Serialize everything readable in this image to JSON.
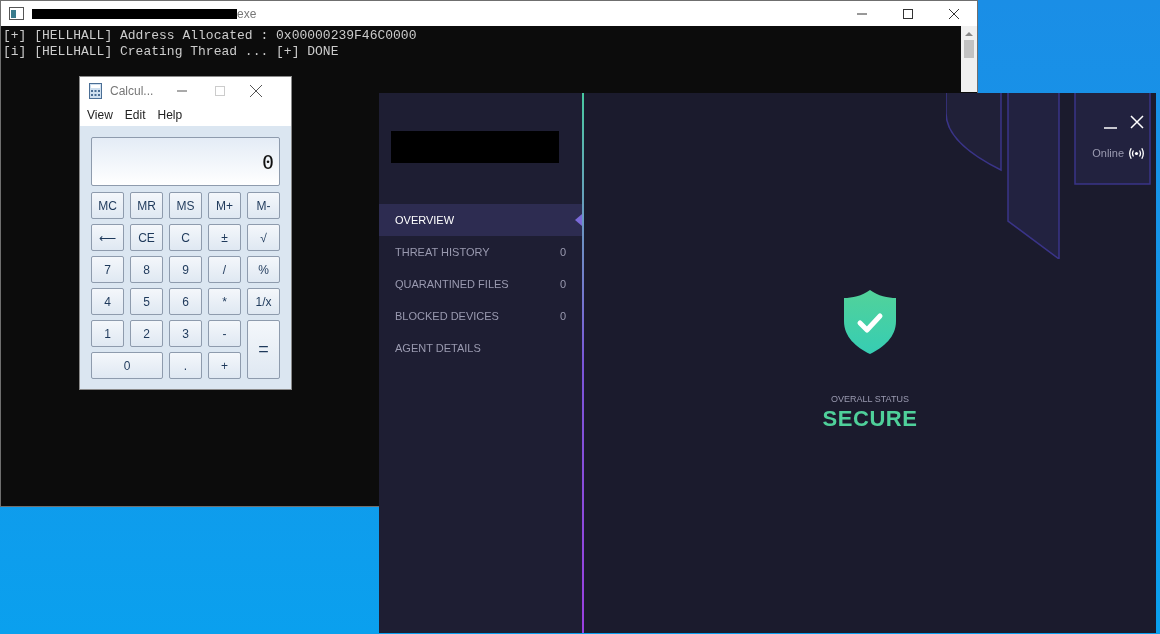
{
  "console": {
    "title": "exe",
    "lines": [
      "[+] [HELLHALL] Address Allocated : 0x00000239F46C0000",
      "[i] [HELLHALL] Creating Thread ... [+] DONE"
    ]
  },
  "calculator": {
    "title": "Calcul...",
    "menu": [
      "View",
      "Edit",
      "Help"
    ],
    "display": "0",
    "keys": [
      {
        "label": "MC",
        "kind": "key"
      },
      {
        "label": "MR",
        "kind": "key"
      },
      {
        "label": "MS",
        "kind": "key"
      },
      {
        "label": "M+",
        "kind": "key"
      },
      {
        "label": "M-",
        "kind": "key"
      },
      {
        "label": "⟵",
        "kind": "key"
      },
      {
        "label": "CE",
        "kind": "key"
      },
      {
        "label": "C",
        "kind": "key"
      },
      {
        "label": "±",
        "kind": "key"
      },
      {
        "label": "√",
        "kind": "key"
      },
      {
        "label": "7",
        "kind": "key"
      },
      {
        "label": "8",
        "kind": "key"
      },
      {
        "label": "9",
        "kind": "key"
      },
      {
        "label": "/",
        "kind": "key"
      },
      {
        "label": "%",
        "kind": "key"
      },
      {
        "label": "4",
        "kind": "key"
      },
      {
        "label": "5",
        "kind": "key"
      },
      {
        "label": "6",
        "kind": "key"
      },
      {
        "label": "*",
        "kind": "key"
      },
      {
        "label": "1/x",
        "kind": "key"
      },
      {
        "label": "1",
        "kind": "key"
      },
      {
        "label": "2",
        "kind": "key"
      },
      {
        "label": "3",
        "kind": "key"
      },
      {
        "label": "-",
        "kind": "key"
      },
      {
        "label": "=",
        "kind": "tall"
      },
      {
        "label": "0",
        "kind": "wide"
      },
      {
        "label": ".",
        "kind": "key"
      },
      {
        "label": "+",
        "kind": "key"
      }
    ]
  },
  "security_app": {
    "connection": "Online",
    "sidebar": {
      "items": [
        {
          "label": "OVERVIEW",
          "selected": true
        },
        {
          "label": "THREAT HISTORY",
          "count": "0",
          "selected": false
        },
        {
          "label": "QUARANTINED FILES",
          "count": "0",
          "selected": false
        },
        {
          "label": "BLOCKED DEVICES",
          "count": "0",
          "selected": false
        },
        {
          "label": "AGENT DETAILS",
          "selected": false
        }
      ]
    },
    "status": {
      "label": "OVERALL STATUS",
      "value": "SECURE"
    }
  }
}
